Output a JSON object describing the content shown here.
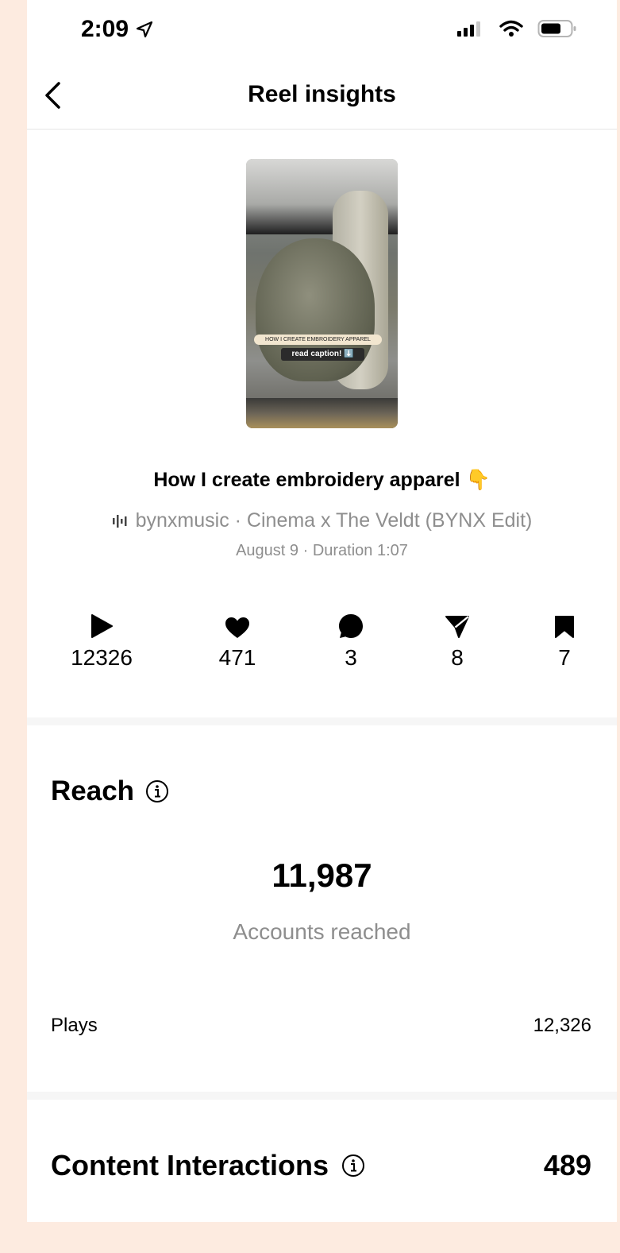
{
  "status_bar": {
    "time": "2:09"
  },
  "header": {
    "title": "Reel insights"
  },
  "thumbnail": {
    "overlay_line1": "HOW I CREATE EMBROIDERY APPAREL",
    "overlay_line2": "read caption! ⬇️"
  },
  "reel": {
    "title": "How I create embroidery apparel 👇",
    "audio": "bynxmusic · Cinema x The Veldt (BYNX Edit)",
    "meta": "August 9 · Duration 1:07"
  },
  "stats": [
    {
      "icon": "play-icon",
      "value": "12326"
    },
    {
      "icon": "heart-icon",
      "value": "471"
    },
    {
      "icon": "comment-icon",
      "value": "3"
    },
    {
      "icon": "send-icon",
      "value": "8"
    },
    {
      "icon": "bookmark-icon",
      "value": "7"
    }
  ],
  "reach": {
    "heading": "Reach",
    "accounts_reached": "11,987",
    "accounts_reached_label": "Accounts reached",
    "plays_label": "Plays",
    "plays_value": "12,326"
  },
  "content_interactions": {
    "heading": "Content Interactions",
    "value": "489"
  }
}
